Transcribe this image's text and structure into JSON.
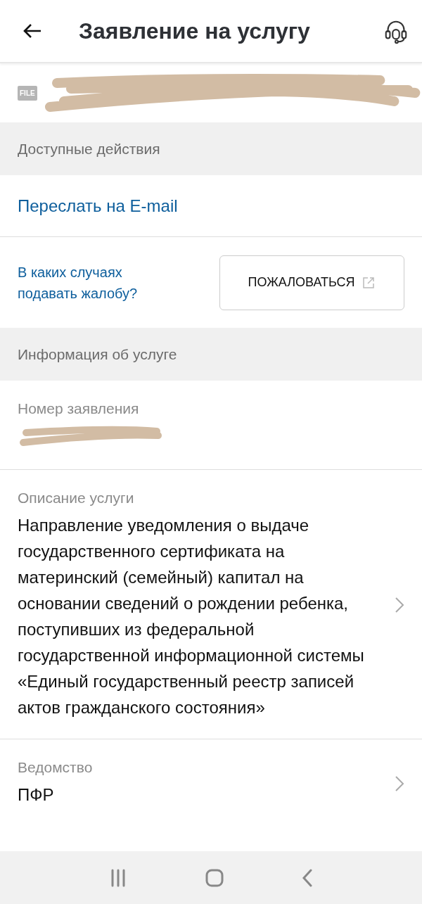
{
  "header": {
    "title": "Заявление на услугу"
  },
  "file": {
    "badge": "FILE"
  },
  "actions": {
    "title": "Доступные действия",
    "email_link": "Переслать на E-mail",
    "complaint_link": "В каких случаях подавать жалобу?",
    "complaint_button": "ПОЖАЛОВАТЬСЯ"
  },
  "info": {
    "title": "Информация об услуге",
    "fields": [
      {
        "kind": "redacted",
        "label": "Номер заявления"
      },
      {
        "kind": "link",
        "label": "Описание услуги",
        "value": "Направление уведомления о выдаче государственного сертификата на материнский (семейный) капитал на основании сведений о рождении ребенка, поступивших из федеральной государственной информационной системы «Единый государственный реестр записей актов гражданского состояния»"
      },
      {
        "kind": "link",
        "label": "Ведомство",
        "value": "ПФР"
      }
    ]
  }
}
